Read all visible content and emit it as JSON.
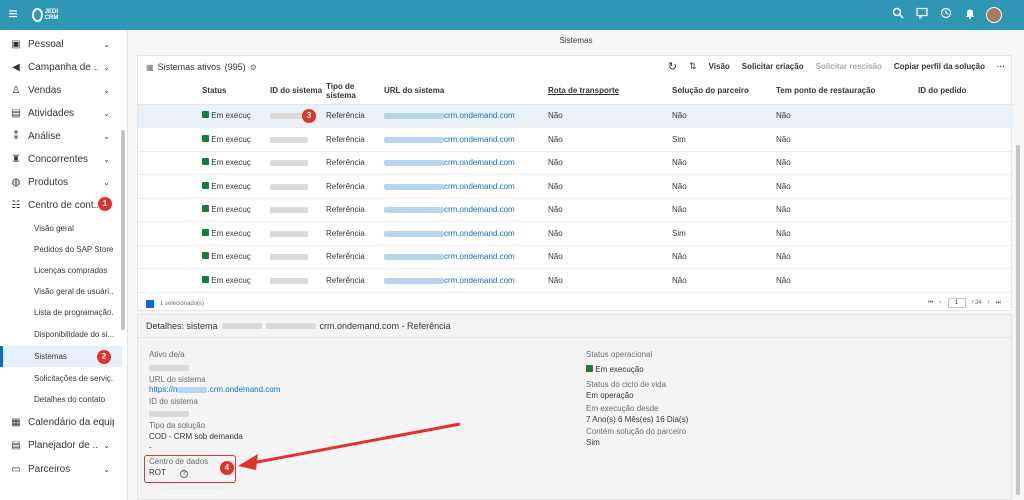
{
  "topbar": {
    "logo_text": "JEDI CRM",
    "icons": [
      "search-icon",
      "chat-icon",
      "history-icon",
      "bell-icon",
      "user-avatar"
    ]
  },
  "sidebar": {
    "items": [
      {
        "label": "Pessoal",
        "icon": "pessoal-icon"
      },
      {
        "label": "Campanha de ...",
        "icon": "campaign-icon"
      },
      {
        "label": "Vendas",
        "icon": "sales-icon"
      },
      {
        "label": "Atividades",
        "icon": "activities-icon"
      },
      {
        "label": "Análise",
        "icon": "analysis-icon"
      },
      {
        "label": "Concorrentes",
        "icon": "competitors-icon"
      },
      {
        "label": "Produtos",
        "icon": "products-icon"
      },
      {
        "label": "Centro de cont...",
        "icon": "control-center-icon"
      }
    ],
    "subitems": [
      "Visão geral",
      "Pedidos do SAP Store",
      "Licenças compradas",
      "Visão geral de usuári...",
      "Lista de programação...",
      "Disponibilidade do si...",
      "Sistemas",
      "Solicitações de serviç...",
      "Detalhes do contato"
    ],
    "bottom_items": [
      {
        "label": "Calendário da equipe",
        "icon": "calendar-icon"
      },
      {
        "label": "Planejador de ...",
        "icon": "planner-icon"
      },
      {
        "label": "Parceiros",
        "icon": "partners-icon"
      }
    ]
  },
  "badges": {
    "b1": "1",
    "b2": "2",
    "b3": "3",
    "b4": "4"
  },
  "page": {
    "title": "Sistemas"
  },
  "toolbar": {
    "title": "Sistemas ativos",
    "count": "(995)",
    "visao": "Visão",
    "solicitar_criacao": "Solicitar criação",
    "solicitar_rescisao": "Solicitar rescisão",
    "copiar_perfil": "Copiar perfil da solução",
    "more": "···"
  },
  "table": {
    "headers": {
      "status": "Status",
      "id": "ID do sistema",
      "tipo": "Tipo de sistema",
      "url": "URL do sistema",
      "rota": "Rota de transporte",
      "solucao": "Solução do parceiro",
      "restauracao": "Tem ponto de restauração",
      "pedido": "ID do pedido"
    },
    "rows": [
      {
        "status": "Em execuç",
        "tipo": "Referência",
        "url": "crm.ondemand.com",
        "rota": "Não",
        "solucao": "Não",
        "restauracao": "Não"
      },
      {
        "status": "Em execuç",
        "tipo": "Referência",
        "url": "crm.ondemand.com",
        "rota": "Não",
        "solucao": "Sim",
        "restauracao": "Não"
      },
      {
        "status": "Em execuç",
        "tipo": "Referência",
        "url": "crm.ondemand.com",
        "rota": "Não",
        "solucao": "Não",
        "restauracao": "Não"
      },
      {
        "status": "Em execuç",
        "tipo": "Referência",
        "url": "crm.ondemand.com",
        "rota": "Não",
        "solucao": "Não",
        "restauracao": "Não"
      },
      {
        "status": "Em execuç",
        "tipo": "Referência",
        "url": "crm.ondemand.com",
        "rota": "Não",
        "solucao": "Não",
        "restauracao": "Não"
      },
      {
        "status": "Em execuç",
        "tipo": "Referência",
        "url": "crm.ondemand.com",
        "rota": "Não",
        "solucao": "Sim",
        "restauracao": "Não"
      },
      {
        "status": "Em execuç",
        "tipo": "Referência",
        "url": "crm.ondemand.com",
        "rota": "Não",
        "solucao": "Não",
        "restauracao": "Não"
      },
      {
        "status": "Em execuç",
        "tipo": "Referência",
        "url": "crm.ondemand.com",
        "rota": "Não",
        "solucao": "Não",
        "restauracao": "Não"
      }
    ],
    "selected_text": "1 selecionado(s)",
    "page_current": "1",
    "page_total": "/ 34"
  },
  "details": {
    "title_prefix": "Detalhes: sistema",
    "title_url": "crm.ondemand.com - Referência",
    "ativo_label": "Ativo de/a",
    "url_label": "URL do sistema",
    "url_value": "https://n",
    "url_value2": ".crm.ondemand.com",
    "id_label": "ID do sistema",
    "tipo_label": "Tipo da solução",
    "tipo_value": "COD - CRM sob demanda",
    "dash": "-",
    "centro_label": "Centro de dados",
    "centro_value": "ROT",
    "status_op_label": "Status operacional",
    "status_op_value": "Em execução",
    "ciclo_label": "Status do ciclo de vida",
    "ciclo_value": "Em operação",
    "desde_label": "Em execução desde",
    "desde_value": "7 Ano(s) 6 Mês(es) 16 Dia(s)",
    "contem_label": "Contém solução do parceiro",
    "contem_value": "Sim"
  },
  "colors": {
    "topbar": "#3096b6",
    "accent": "#0a6ed1",
    "badge": "#e1332a",
    "status_ok": "#107e3e"
  }
}
